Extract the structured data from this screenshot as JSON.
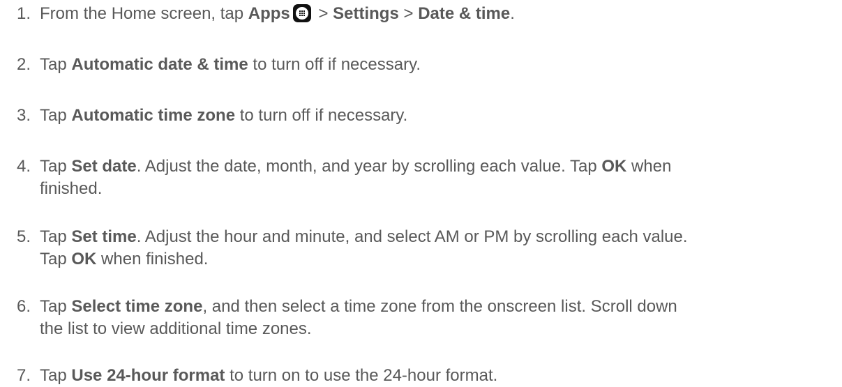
{
  "steps": [
    {
      "num": "1.",
      "parts": [
        "From the Home screen, tap ",
        "Apps",
        " > ",
        "Settings",
        " > ",
        "Date & time",
        "."
      ]
    },
    {
      "num": "2.",
      "parts": [
        "Tap ",
        "Automatic date & time",
        " to turn off if necessary."
      ]
    },
    {
      "num": "3.",
      "parts": [
        "Tap ",
        "Automatic time zone",
        " to turn off if necessary."
      ]
    },
    {
      "num": "4.",
      "parts": [
        "Tap ",
        "Set date",
        ". Adjust the date, month, and year by scrolling each value. Tap ",
        "OK",
        " when",
        "finished."
      ]
    },
    {
      "num": "5.",
      "parts": [
        "Tap ",
        "Set time",
        ". Adjust the hour and minute, and select AM or PM by scrolling each value.",
        "Tap ",
        "OK",
        " when finished."
      ]
    },
    {
      "num": "6.",
      "parts": [
        "Tap ",
        "Select time zone",
        ", and then select a time zone from the onscreen list. Scroll down",
        "the list to view additional time zones."
      ]
    },
    {
      "num": "7.",
      "parts": [
        "Tap ",
        "Use 24-hour format",
        " to turn on to use the 24-hour format."
      ]
    }
  ],
  "icons": {
    "apps_icon": "apps-grid-icon"
  }
}
